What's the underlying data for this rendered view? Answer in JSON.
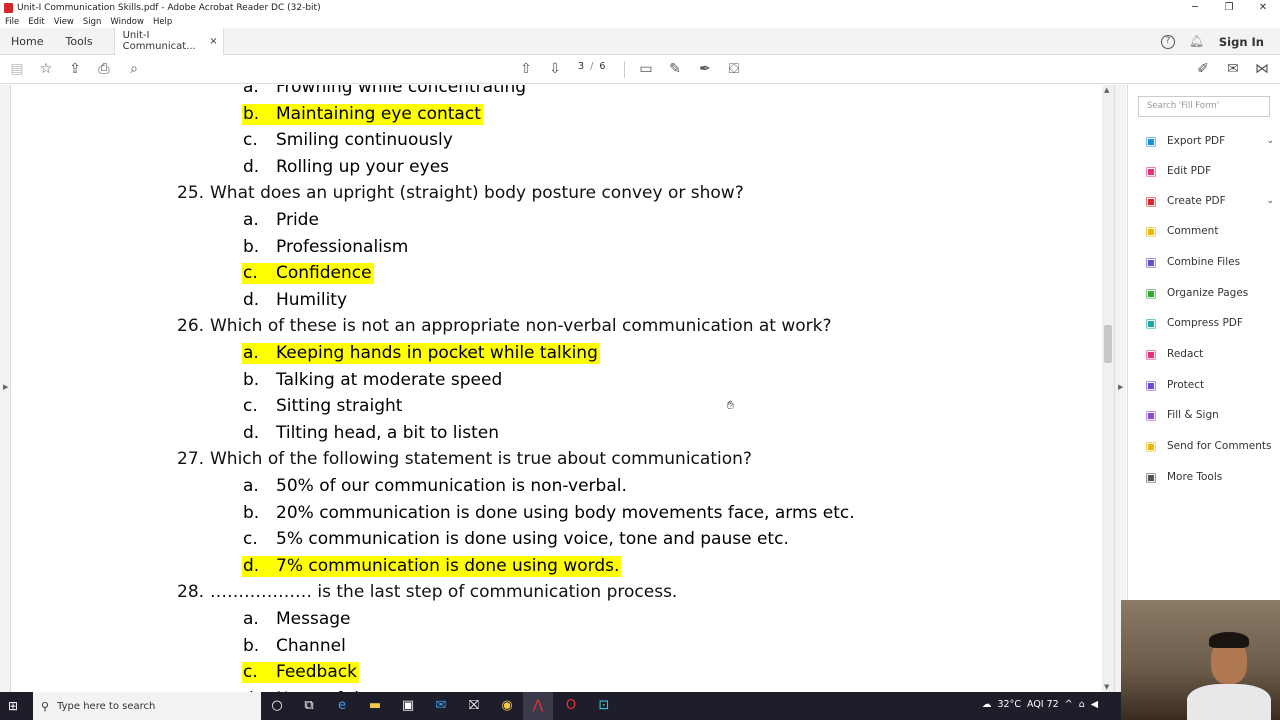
{
  "window": {
    "title": "Unit-I Communication Skills.pdf - Adobe Acrobat Reader DC (32-bit)",
    "minimize": "─",
    "maximize": "❐",
    "close": "✕"
  },
  "menu": [
    "File",
    "Edit",
    "View",
    "Sign",
    "Window",
    "Help"
  ],
  "tabs": {
    "home": "Home",
    "tools": "Tools",
    "document": "Unit-I Communicat...",
    "close": "×",
    "help_icon": "?",
    "sign_in": "Sign In"
  },
  "toolbar": {
    "page_current": "3",
    "page_separator": "/",
    "page_total": "6"
  },
  "right_panel": {
    "search_placeholder": "Search 'Fill Form'",
    "tools": [
      {
        "label": "Export PDF",
        "color": "#1e8fd6",
        "icon": "export-pdf-icon",
        "chevron": true
      },
      {
        "label": "Edit PDF",
        "color": "#e0327a",
        "icon": "edit-pdf-icon",
        "chevron": false
      },
      {
        "label": "Create PDF",
        "color": "#d8262d",
        "icon": "create-pdf-icon",
        "chevron": true
      },
      {
        "label": "Comment",
        "color": "#f2b705",
        "icon": "comment-icon",
        "chevron": false
      },
      {
        "label": "Combine Files",
        "color": "#6a4bd1",
        "icon": "combine-files-icon",
        "chevron": false
      },
      {
        "label": "Organize Pages",
        "color": "#3aa335",
        "icon": "organize-pages-icon",
        "chevron": false
      },
      {
        "label": "Compress PDF",
        "color": "#1ea7a0",
        "icon": "compress-pdf-icon",
        "chevron": false
      },
      {
        "label": "Redact",
        "color": "#e0327a",
        "icon": "redact-icon",
        "chevron": false
      },
      {
        "label": "Protect",
        "color": "#6a4bd1",
        "icon": "protect-icon",
        "chevron": false
      },
      {
        "label": "Fill & Sign",
        "color": "#8a4bd1",
        "icon": "fill-sign-icon",
        "chevron": false
      },
      {
        "label": "Send for Comments",
        "color": "#f2b705",
        "icon": "send-for-comments-icon",
        "chevron": false
      },
      {
        "label": "More Tools",
        "color": "#555555",
        "icon": "more-tools-icon",
        "chevron": false
      }
    ]
  },
  "document": {
    "lines": [
      {
        "kind": "opt",
        "letter": "a.",
        "text": "Frowning while concentrating",
        "hl": false
      },
      {
        "kind": "opt",
        "letter": "b.",
        "text": "Maintaining eye contact",
        "hl": true
      },
      {
        "kind": "opt",
        "letter": "c.",
        "text": "Smiling continuously",
        "hl": false
      },
      {
        "kind": "opt",
        "letter": "d.",
        "text": "Rolling up your eyes",
        "hl": false
      },
      {
        "kind": "q",
        "num": "25.",
        "text": "What does an upright (straight) body posture convey or show?"
      },
      {
        "kind": "opt",
        "letter": "a.",
        "text": "Pride",
        "hl": false
      },
      {
        "kind": "opt",
        "letter": "b.",
        "text": "Professionalism",
        "hl": false
      },
      {
        "kind": "opt",
        "letter": "c.",
        "text": "Confidence",
        "hl": true
      },
      {
        "kind": "opt",
        "letter": "d.",
        "text": "Humility",
        "hl": false
      },
      {
        "kind": "q",
        "num": "26.",
        "text": "Which of these is not an appropriate non-verbal communication at work?"
      },
      {
        "kind": "opt",
        "letter": "a.",
        "text": "Keeping hands in pocket while talking",
        "hl": true
      },
      {
        "kind": "opt",
        "letter": "b.",
        "text": "Talking at moderate speed",
        "hl": false
      },
      {
        "kind": "opt",
        "letter": "c.",
        "text": "Sitting straight",
        "hl": false
      },
      {
        "kind": "opt",
        "letter": "d.",
        "text": "Tilting head, a bit to listen",
        "hl": false
      },
      {
        "kind": "q",
        "num": "27.",
        "text": "Which of the following statement is true about communication?"
      },
      {
        "kind": "opt",
        "letter": "a.",
        "text": "50% of our communication is non-verbal.",
        "hl": false
      },
      {
        "kind": "opt",
        "letter": "b.",
        "text": "20% communication is done using body movements face, arms etc.",
        "hl": false
      },
      {
        "kind": "opt",
        "letter": "c.",
        "text": "5% communication is done using voice, tone and pause etc.",
        "hl": false
      },
      {
        "kind": "opt",
        "letter": "d.",
        "text": "7% communication is done using words.",
        "hl": true
      },
      {
        "kind": "q",
        "num": "28.",
        "text": "……………… is the last step of communication process."
      },
      {
        "kind": "opt",
        "letter": "a.",
        "text": "Message",
        "hl": false
      },
      {
        "kind": "opt",
        "letter": "b.",
        "text": "Channel",
        "hl": false
      },
      {
        "kind": "opt",
        "letter": "c.",
        "text": "Feedback",
        "hl": true
      },
      {
        "kind": "opt",
        "letter": "d.",
        "text": "None of the",
        "hl": false
      }
    ]
  },
  "taskbar": {
    "search_placeholder": "Type here to search",
    "temperature": "32°C",
    "aqi": "AQI 72",
    "tray_chevron": "^"
  }
}
